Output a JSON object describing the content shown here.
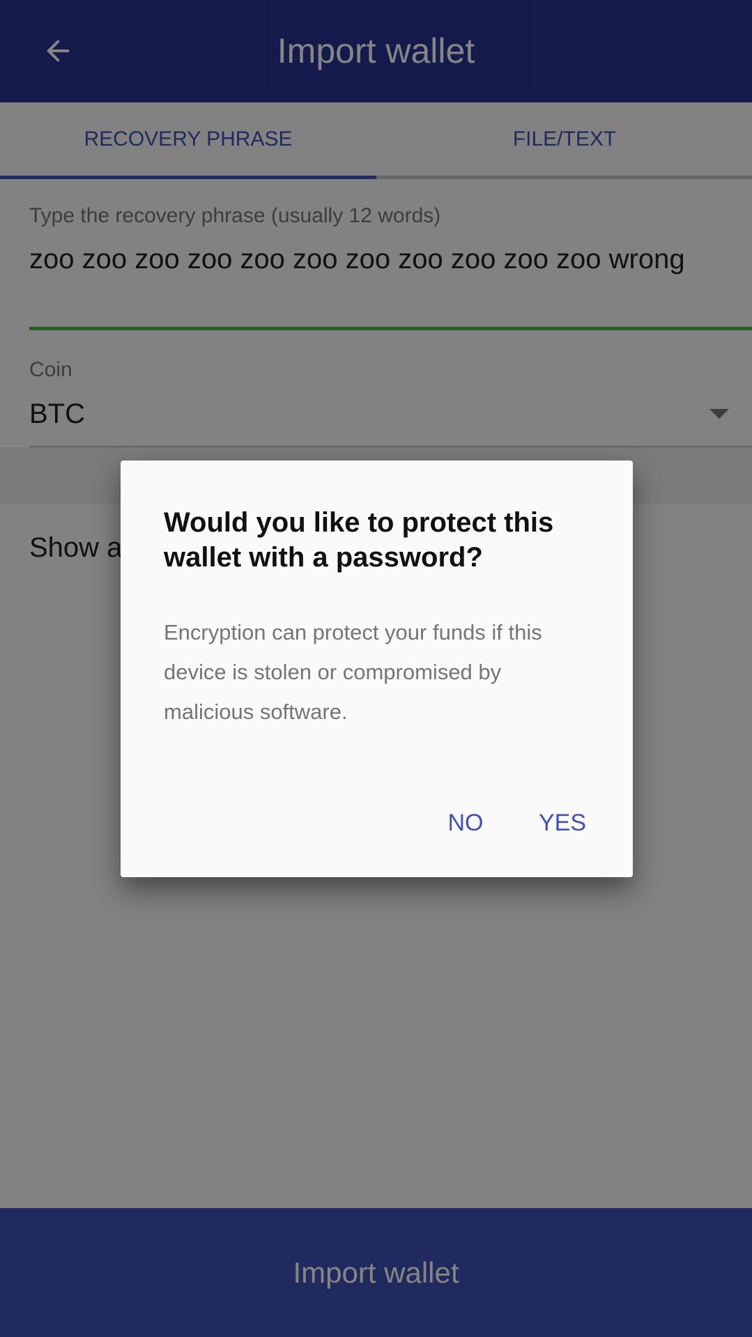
{
  "toolbar": {
    "title": "Import wallet",
    "back_icon": "arrow-left-icon"
  },
  "tabs": [
    {
      "label": "RECOVERY PHRASE",
      "selected": true
    },
    {
      "label": "FILE/TEXT",
      "selected": false
    }
  ],
  "phrase_field": {
    "label": "Type the recovery phrase (usually 12 words)",
    "value": "zoo zoo zoo zoo zoo zoo zoo zoo zoo zoo zoo wrong"
  },
  "coin_field": {
    "label": "Coin",
    "value": "BTC"
  },
  "show_row": {
    "label_partial": "Show a"
  },
  "import_button": {
    "label": "Import wallet"
  },
  "dialog": {
    "title": "Would you like to protect this wallet with a password?",
    "message": "Encryption can protect your funds if this device is stolen or compromised by malicious software.",
    "no_label": "NO",
    "yes_label": "YES"
  },
  "colors": {
    "toolbar": "#283593",
    "accent": "#3f51b5",
    "valid_underline": "#4caf50"
  }
}
